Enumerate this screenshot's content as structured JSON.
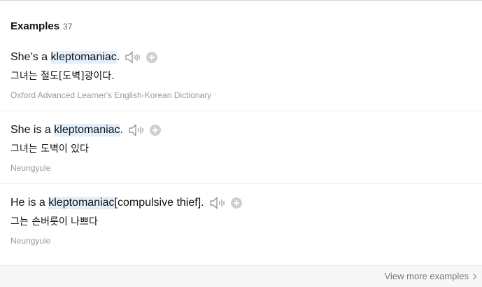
{
  "section": {
    "title": "Examples",
    "count": "37"
  },
  "examples": [
    {
      "prefix": "She’s a ",
      "keyword": "kleptomaniac",
      "suffix": ".",
      "translation": "그녀는 절도[도벽]광이다.",
      "source": "Oxford Advanced Learner's English-Korean Dictionary"
    },
    {
      "prefix": "She is a ",
      "keyword": "kleptomaniac",
      "suffix": ".",
      "translation": "그녀는 도벽이 있다",
      "source": "Neungyule"
    },
    {
      "prefix": "He is a ",
      "keyword": "kleptomaniac",
      "suffix": "[compulsive thief].",
      "translation": "그는 손버릇이 나쁘다",
      "source": "Neungyule"
    }
  ],
  "footer": {
    "view_more": "View more examples"
  },
  "icons": {
    "speaker": "speaker-icon",
    "add": "plus-circle-icon",
    "chevron": "chevron-right-icon"
  },
  "colors": {
    "highlight": "#e3f0fb",
    "muted_text": "#9a9a9a",
    "plus_circle": "#cfcfcf"
  }
}
